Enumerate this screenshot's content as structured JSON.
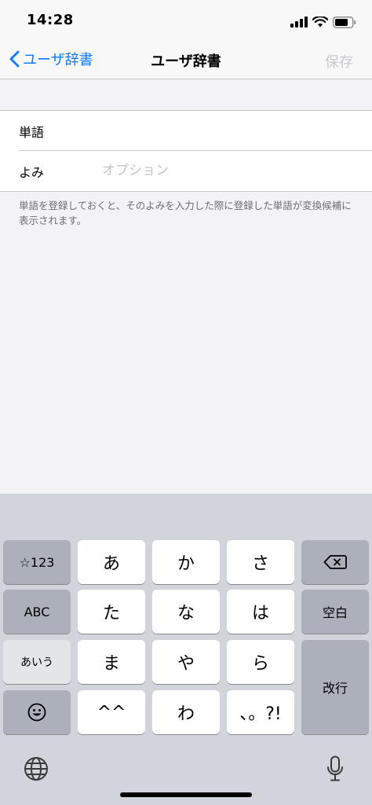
{
  "status_bar": {
    "time": "14:28"
  },
  "nav": {
    "back_label": "ユーザ辞書",
    "title": "ユーザ辞書",
    "save_label": "保存"
  },
  "form": {
    "word_label": "単語",
    "word_value": "",
    "reading_label": "よみ",
    "reading_placeholder": "オプション"
  },
  "note": "単語を登録しておくと、そのよみを入力した際に登録した単語が変換候補に表示されます。",
  "keyboard": {
    "row1": {
      "left": "☆123",
      "keys": [
        "あ",
        "か",
        "さ"
      ]
    },
    "row2": {
      "left": "ABC",
      "keys": [
        "た",
        "な",
        "は"
      ],
      "right": "空白"
    },
    "row3": {
      "left": "あいう",
      "keys": [
        "ま",
        "や",
        "ら"
      ]
    },
    "row4": {
      "keys": [
        "^^",
        "わ",
        "、。?!"
      ]
    },
    "return_label": "改行"
  },
  "colors": {
    "accent": "#0a7aff",
    "disabled": "#c7c7cc",
    "background": "#f2f2f7",
    "keyboard_bg": "#d2d4db"
  }
}
